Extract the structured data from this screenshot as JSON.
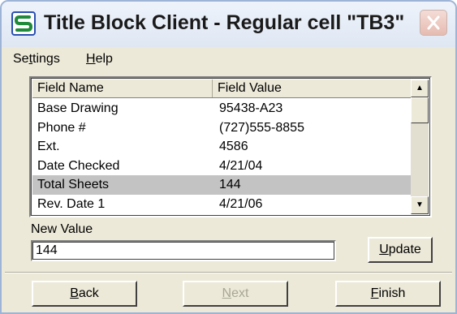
{
  "window": {
    "title": "Title Block Client - Regular cell \"TB3\""
  },
  "menu": {
    "settings_pre": "Se",
    "settings_ul": "t",
    "settings_post": "tings",
    "help_ul": "H",
    "help_post": "elp"
  },
  "list": {
    "columns": [
      "Field Name",
      "Field Value"
    ],
    "rows": [
      {
        "name": "Base Drawing",
        "value": "95438-A23"
      },
      {
        "name": "Phone #",
        "value": "(727)555-8855"
      },
      {
        "name": "Ext.",
        "value": "4586"
      },
      {
        "name": "Date Checked",
        "value": "4/21/04"
      },
      {
        "name": "Total Sheets",
        "value": "144"
      },
      {
        "name": "Rev. Date 1",
        "value": "4/21/06"
      }
    ],
    "selected_index": 4
  },
  "new_value": {
    "label": "New Value",
    "value": "144"
  },
  "buttons": {
    "update_ul": "U",
    "update_post": "pdate",
    "back_ul": "B",
    "back_post": "ack",
    "next_ul": "N",
    "next_post": "ext",
    "finish_ul": "F",
    "finish_post": "inish"
  },
  "icons": {
    "app": "green-s-icon",
    "close": "close-icon",
    "scroll_up": "arrow-up-icon",
    "scroll_down": "arrow-down-icon"
  },
  "colors": {
    "title_bar": "#dfe7f3",
    "dialog_face": "#ece9d8",
    "selected_row": "#c3c3c3",
    "close_button": "#e6bbb1",
    "app_icon_green": "#1f8a3a",
    "app_icon_blue": "#2a4fb0"
  }
}
